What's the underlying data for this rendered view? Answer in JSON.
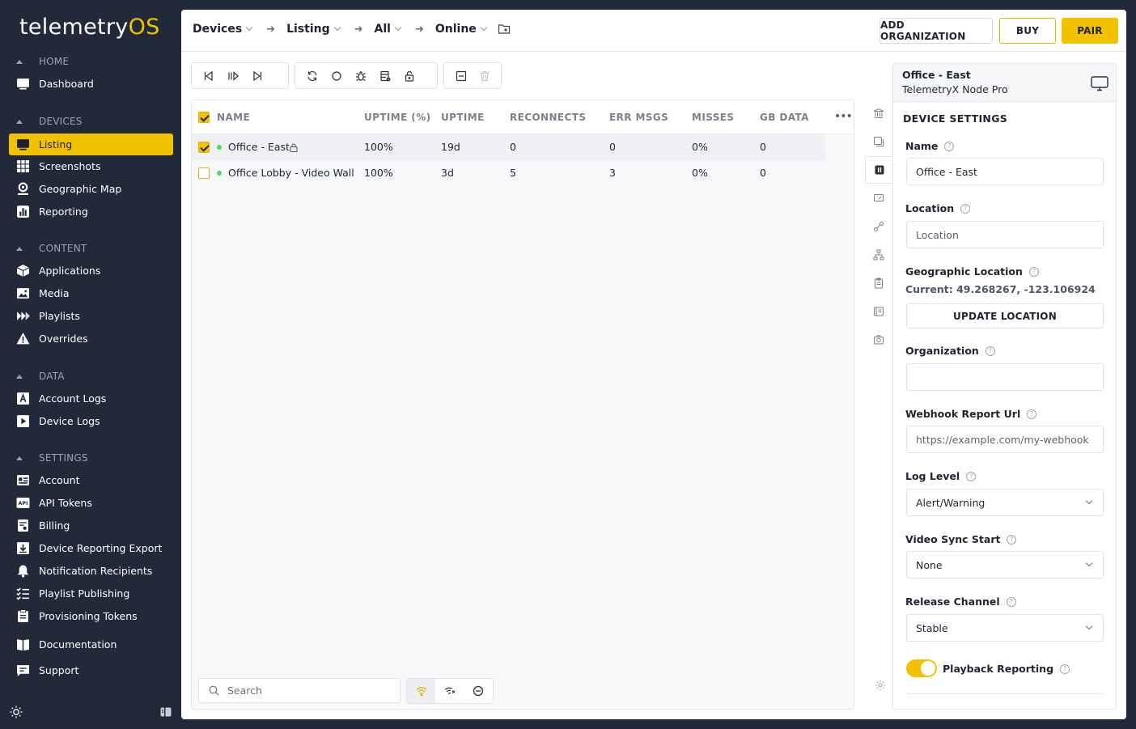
{
  "app": {
    "logo_main": "telemetry",
    "logo_accent": "OS",
    "accent_color": "#f2c100",
    "sidebar_bg": "#222a3a"
  },
  "sidebar": {
    "sections": [
      {
        "title": "HOME",
        "items": [
          {
            "label": "Dashboard",
            "icon": "monitor-icon"
          }
        ]
      },
      {
        "title": "DEVICES",
        "items": [
          {
            "label": "Listing",
            "icon": "monitor-icon",
            "active": true
          },
          {
            "label": "Screenshots",
            "icon": "grid-icon"
          },
          {
            "label": "Geographic Map",
            "icon": "pin-icon"
          },
          {
            "label": "Reporting",
            "icon": "chart-icon"
          }
        ]
      },
      {
        "title": "CONTENT",
        "items": [
          {
            "label": "Applications",
            "icon": "cube-icon"
          },
          {
            "label": "Media",
            "icon": "image-icon"
          },
          {
            "label": "Playlists",
            "icon": "playlist-icon"
          },
          {
            "label": "Overrides",
            "icon": "warning-icon"
          }
        ]
      },
      {
        "title": "DATA",
        "items": [
          {
            "label": "Account Logs",
            "icon": "account-log-icon"
          },
          {
            "label": "Device Logs",
            "icon": "device-log-icon"
          }
        ]
      },
      {
        "title": "SETTINGS",
        "items": [
          {
            "label": "Account",
            "icon": "id-card-icon"
          },
          {
            "label": "API Tokens",
            "icon": "api-icon"
          },
          {
            "label": "Billing",
            "icon": "billing-icon"
          },
          {
            "label": "Device Reporting Export",
            "icon": "download-icon"
          },
          {
            "label": "Notification Recipients",
            "icon": "bell-icon"
          },
          {
            "label": "Playlist Publishing",
            "icon": "checklist-icon"
          },
          {
            "label": "Provisioning Tokens",
            "icon": "clipboard-icon"
          }
        ]
      }
    ],
    "extra": [
      {
        "label": "Documentation",
        "icon": "book-icon"
      },
      {
        "label": "Support",
        "icon": "chat-icon"
      }
    ]
  },
  "breadcrumb": {
    "items": [
      "Devices",
      "Listing",
      "All",
      "Online"
    ]
  },
  "header_buttons": {
    "add_org": "ADD ORGANIZATION",
    "buy": "BUY",
    "pair": "PAIR"
  },
  "table": {
    "columns": [
      "NAME",
      "UPTIME (%)",
      "UPTIME",
      "RECONNECTS",
      "ERR MSGS",
      "MISSES",
      "GB DATA"
    ],
    "rows": [
      {
        "name": "Office - East",
        "uptime_pct": "100%",
        "uptime": "19d",
        "reconnects": "0",
        "err_msgs": "0",
        "misses": "0%",
        "gb_data": "0",
        "selected": true,
        "locked": true
      },
      {
        "name": "Office Lobby - Video Wall",
        "uptime_pct": "100%",
        "uptime": "3d",
        "reconnects": "5",
        "err_msgs": "3",
        "misses": "0%",
        "gb_data": "0",
        "selected": false,
        "locked": false
      }
    ],
    "more": "•••"
  },
  "search": {
    "placeholder": "Search"
  },
  "device_panel": {
    "title": "Office - East",
    "subtitle": "TelemetryX Node Pro",
    "section_title": "DEVICE SETTINGS",
    "name_label": "Name",
    "name_value": "Office - East",
    "location_label": "Location",
    "location_placeholder": "Location",
    "geo_label": "Geographic Location",
    "geo_current": "Current: 49.268267, -123.106924",
    "update_location": "UPDATE LOCATION",
    "org_label": "Organization",
    "org_value": "",
    "webhook_label": "Webhook Report Url",
    "webhook_placeholder": "https://example.com/my-webhook",
    "log_level_label": "Log Level",
    "log_level_value": "Alert/Warning",
    "video_sync_label": "Video Sync Start",
    "video_sync_value": "None",
    "release_channel_label": "Release Channel",
    "release_channel_value": "Stable",
    "playback_label": "Playback Reporting",
    "playback_on": true,
    "help_glyph": "?"
  }
}
